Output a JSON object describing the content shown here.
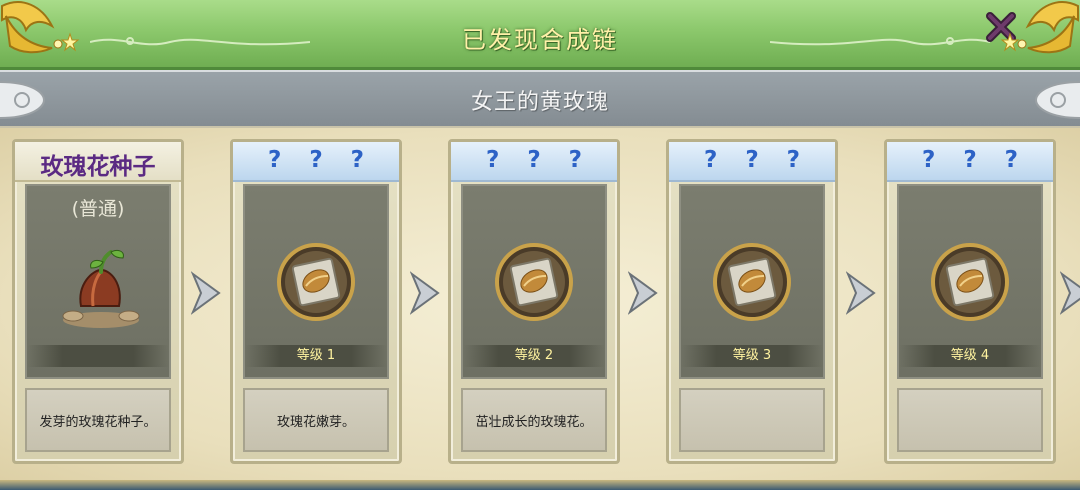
{
  "header": {
    "title": "已发现合成链"
  },
  "subheader": {
    "title": "女王的黄玫瑰"
  },
  "cards": [
    {
      "name": "玫瑰花种子",
      "rarity": "(普通)",
      "level": "",
      "desc": "发芽的玫瑰花种子。",
      "icon": "seed-icon"
    },
    {
      "name": "? ? ?",
      "rarity": "",
      "level": "等级 1",
      "desc": "玫瑰花嫩芽。",
      "icon": "book-icon"
    },
    {
      "name": "? ? ?",
      "rarity": "",
      "level": "等级 2",
      "desc": "茁壮成长的玫瑰花。",
      "icon": "book-icon"
    },
    {
      "name": "? ? ?",
      "rarity": "",
      "level": "等级 3",
      "desc": "",
      "icon": "book-icon"
    },
    {
      "name": "? ? ?",
      "rarity": "",
      "level": "等级 4",
      "desc": "",
      "icon": "book-icon"
    }
  ],
  "colors": {
    "header_green": "#8cc86c",
    "title_yellow": "#fff0a8",
    "known_name": "#5b2a83",
    "unknown_name": "#2d62c6",
    "level_text": "#fff3a0"
  }
}
